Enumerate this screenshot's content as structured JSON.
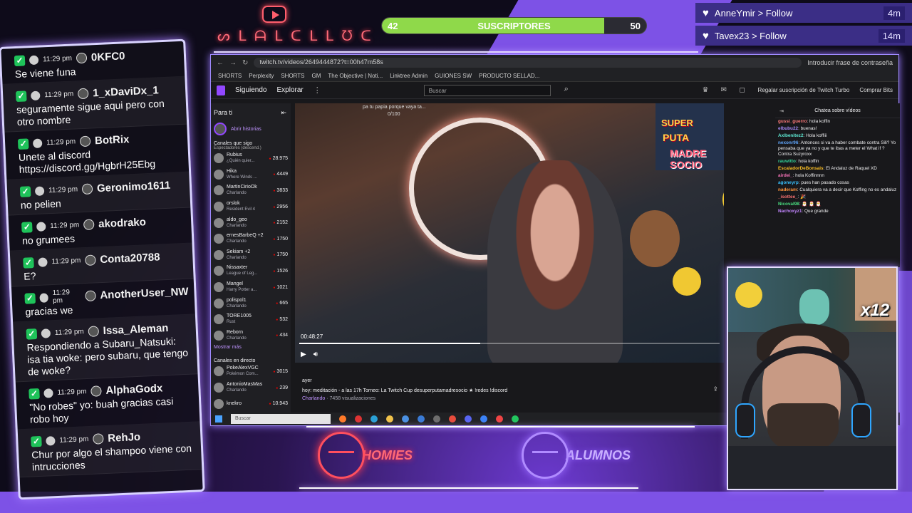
{
  "subscribers": {
    "current": "42",
    "label": "SUSCRIPTORES",
    "goal": "50",
    "progress": 0.84
  },
  "follows": [
    {
      "user_action": "AnneYmir > Follow",
      "ago": "4m"
    },
    {
      "user_action": "Tavex23 > Follow",
      "ago": "14m"
    }
  ],
  "overlay_chat": [
    {
      "time": "11:29 pm",
      "name": "0KFC0",
      "text": "Se viene funa"
    },
    {
      "time": "11:29 pm",
      "name": "1_xDaviDx_1",
      "text": "seguramente sigue aqui pero con otro nombre"
    },
    {
      "time": "11:29 pm",
      "name": "BotRix",
      "text": "Unete al discord https://discord.gg/HgbrH25Ebg"
    },
    {
      "time": "11:29 pm",
      "name": "Geronimo1611",
      "text": "no pelien"
    },
    {
      "time": "11:29 pm",
      "name": "akodrako",
      "text": "no grumees"
    },
    {
      "time": "11:29 pm",
      "name": "Conta20788",
      "text": "E?"
    },
    {
      "time": "11:29 pm",
      "name": "AnotherUser_NW",
      "text": "gracias we"
    },
    {
      "time": "11:29 pm",
      "name": "Issa_Aleman",
      "text": "Respondiendo a Subaru_Natsuki: isa tia woke: pero subaru, que tengo de woke?"
    },
    {
      "time": "11:29 pm",
      "name": "AlphaGodx",
      "text": "\"No robes\" yo: buah gracias casi robo hoy"
    },
    {
      "time": "11:29 pm",
      "name": "RehJo",
      "text": "Chur por algo el shampoo viene con intrucciones"
    }
  ],
  "browser": {
    "url": "twitch.tv/videos/2649444872?t=00h47m58s",
    "password_hint": "Introducir frase de contraseña",
    "bookmarks": [
      "SHORTS",
      "Perplexity",
      "SHORTS",
      "GM",
      "The Objective | Noti...",
      "Linktree Admin",
      "GUIONES SW",
      "PRODUCTO SELLAD..."
    ]
  },
  "twitch": {
    "nav_following": "Siguiendo",
    "nav_browse": "Explorar",
    "search_placeholder": "Buscar",
    "gift_sub": "Regalar suscripción de Twitch Turbo",
    "buy_bits": "Comprar Bits",
    "sidebar_title": "Para ti",
    "stories": "Abrir historias",
    "followed_title": "Canales que sigo",
    "followed_sub": "Espectadores (descend.)",
    "channels": [
      {
        "name": "Rubius",
        "game": "¿Quién quier...",
        "viewers": "28.975"
      },
      {
        "name": "Hika",
        "game": "Where Winds ...",
        "viewers": "4449"
      },
      {
        "name": "MartinCirioOk",
        "game": "Charlando",
        "viewers": "3833"
      },
      {
        "name": "orslok",
        "game": "Resident Evil 4",
        "viewers": "2956"
      },
      {
        "name": "aldo_geo",
        "game": "Charlando",
        "viewers": "2152"
      },
      {
        "name": "ernesBarbeQ +2",
        "game": "Charlando",
        "viewers": "1750"
      },
      {
        "name": "Sekiam +2",
        "game": "Charlando",
        "viewers": "1750"
      },
      {
        "name": "Nissaxter",
        "game": "League of Leg...",
        "viewers": "1526"
      },
      {
        "name": "Mangel",
        "game": "Harry Potter a...",
        "viewers": "1021"
      },
      {
        "name": "polispol1",
        "game": "Charlando",
        "viewers": "665"
      },
      {
        "name": "TORE1005",
        "game": "Rust",
        "viewers": "532"
      },
      {
        "name": "Reborn",
        "game": "Charlando",
        "viewers": "434"
      }
    ],
    "show_more": "Mostrar más",
    "live_title": "Canales en directo",
    "live_channels": [
      {
        "name": "PokeAlexVGC",
        "game": "Pokémon Com...",
        "viewers": "3015"
      },
      {
        "name": "AntonioMasMas",
        "game": "Charlando",
        "viewers": "239"
      },
      {
        "name": "knekro",
        "game": "",
        "viewers": "10.943"
      }
    ],
    "video_time": "00:48:27",
    "video_progress": 0.43,
    "overlay_text": "pa tu papia porque vaya ta...",
    "overlay_num": "0/100",
    "mario_line1": "SUPER",
    "mario_line2": "PUTA",
    "mario_line3": "MADRE SOCIO",
    "date": "ayer",
    "title": "hoy: meditación - a las 17h Torneo: La Twitch Cup desuperputamadresocio ★ !redes !discord",
    "category": "Charlando",
    "views": "· 7458 visualizaciones",
    "chat_header": "Chatea sobre vídeos",
    "chat": [
      {
        "user": "gussi_guerro",
        "text": ": hola koffin"
      },
      {
        "user": "elbubu22",
        "text": ": buenas!"
      },
      {
        "user": "Axlbenitez2",
        "text": ": Hola koffiii"
      },
      {
        "user": "nexonr96",
        "text": ": Antonces si va a haber combate contra Sili? Yo pensaba que ya no y que te ibas a meter el What if ? Contra Suzyroxx"
      },
      {
        "user": "rauwitto",
        "text": ": hola koffin"
      },
      {
        "user": "EscaladorDeBonsais",
        "text": ": El Andaluz de Raquel XD"
      },
      {
        "user": "airdei_",
        "text": ": hola Koffinnnn"
      },
      {
        "user": "agoneyrp",
        "text": ": pues han pasado cosas"
      },
      {
        "user": "naderam",
        "text": ": Cualquiera va a decir que Koffing no es andaluz"
      },
      {
        "user": "_isottee_",
        "text": ": 🎉"
      },
      {
        "user": "Nicoval98",
        "text": ": 🎅 🎅 🎅"
      },
      {
        "user": "Nachoxyz1",
        "text": ": Que grande"
      }
    ],
    "taskbar_search": "Buscar"
  },
  "cam": {
    "multiplier": "x12"
  },
  "logos": {
    "left": "HOMIES",
    "right": "ALUMNOS"
  }
}
